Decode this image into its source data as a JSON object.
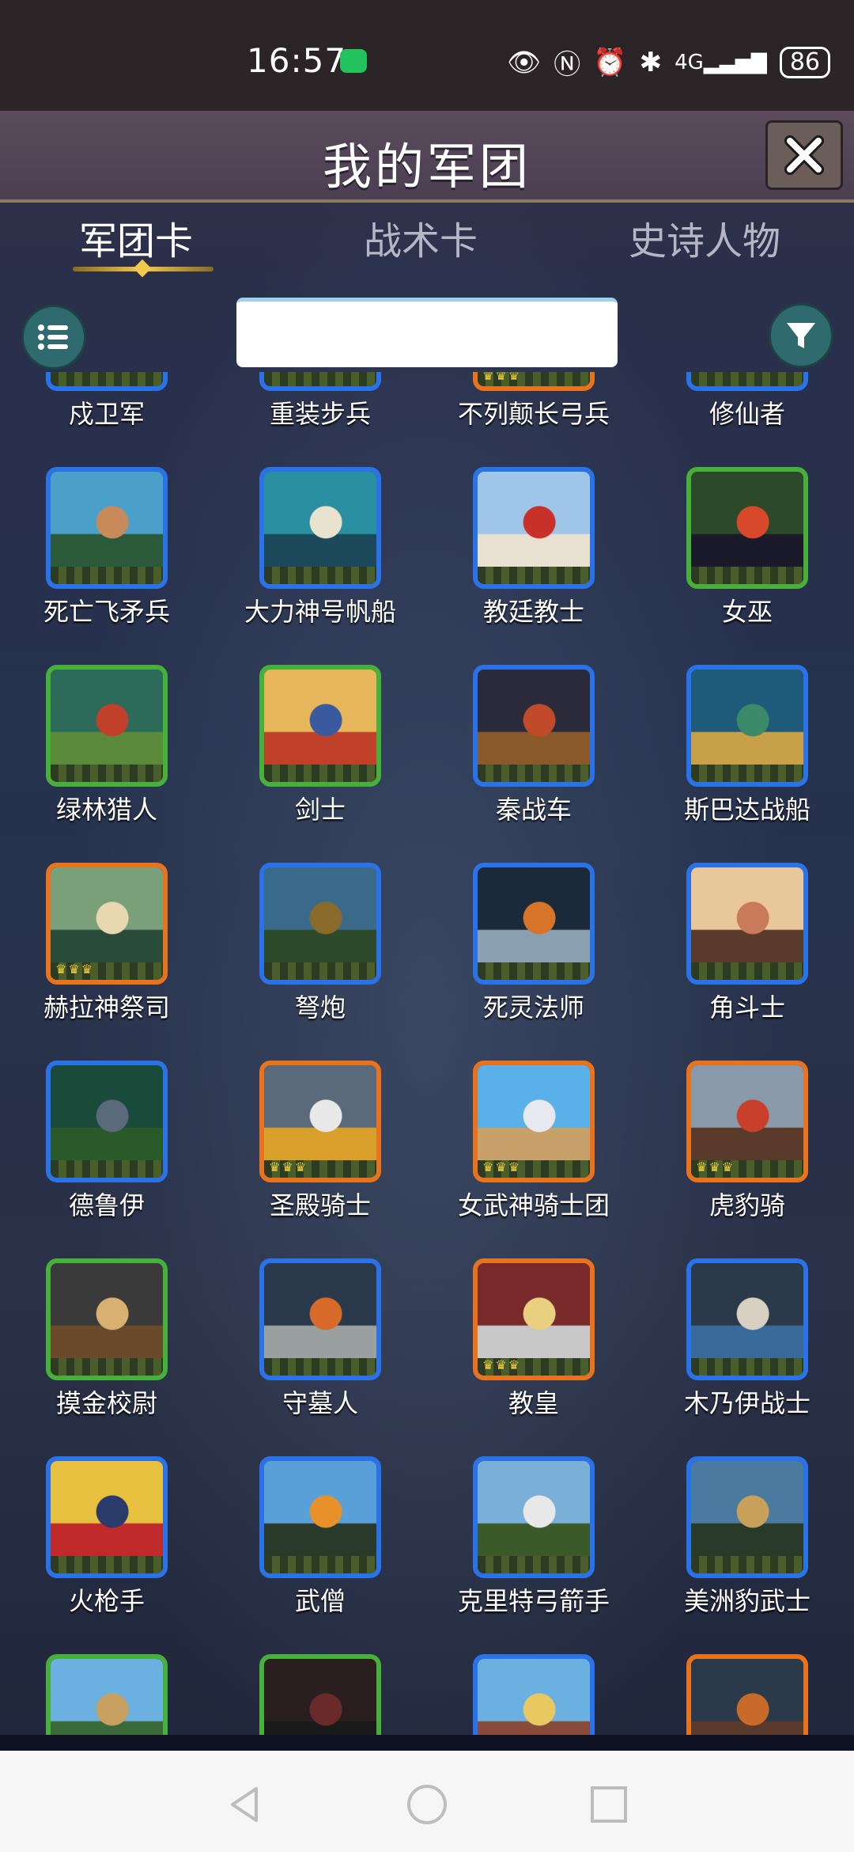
{
  "status_bar": {
    "time": "16:57",
    "battery": "86",
    "icons": [
      "wechat-icon",
      "eye-icon",
      "nfc-icon",
      "alarm-icon",
      "bluetooth-icon",
      "signal-4g-icon"
    ]
  },
  "header": {
    "title": "我的军团",
    "close_icon": "close-icon"
  },
  "tabs": [
    {
      "label": "军团卡",
      "active": true
    },
    {
      "label": "战术卡",
      "active": false
    },
    {
      "label": "史诗人物",
      "active": false
    }
  ],
  "controls": {
    "search_value": "",
    "list_icon": "list-icon",
    "filter_icon": "filter-icon"
  },
  "cards": [
    {
      "name": "戍卫军",
      "rarity": "blue",
      "art": "soldiers"
    },
    {
      "name": "重装步兵",
      "rarity": "blue",
      "art": "infantry"
    },
    {
      "name": "不列颠长弓兵",
      "rarity": "orange",
      "art": "archers"
    },
    {
      "name": "修仙者",
      "rarity": "blue",
      "art": "cultivator"
    },
    {
      "name": "死亡飞矛兵",
      "rarity": "blue",
      "art": "spear"
    },
    {
      "name": "大力神号帆船",
      "rarity": "blue",
      "art": "ship"
    },
    {
      "name": "教廷教士",
      "rarity": "blue",
      "art": "templar"
    },
    {
      "name": "女巫",
      "rarity": "green",
      "art": "witch"
    },
    {
      "name": "绿林猎人",
      "rarity": "green",
      "art": "hunter"
    },
    {
      "name": "剑士",
      "rarity": "green",
      "art": "swordsman"
    },
    {
      "name": "秦战车",
      "rarity": "blue",
      "art": "chariot"
    },
    {
      "name": "斯巴达战船",
      "rarity": "blue",
      "art": "trireme"
    },
    {
      "name": "赫拉神祭司",
      "rarity": "orange",
      "art": "priestess"
    },
    {
      "name": "弩炮",
      "rarity": "blue",
      "art": "ballista"
    },
    {
      "name": "死灵法师",
      "rarity": "blue",
      "art": "necromancer"
    },
    {
      "name": "角斗士",
      "rarity": "blue",
      "art": "gladiator"
    },
    {
      "name": "德鲁伊",
      "rarity": "blue",
      "art": "druid"
    },
    {
      "name": "圣殿骑士",
      "rarity": "orange",
      "art": "knight"
    },
    {
      "name": "女武神骑士团",
      "rarity": "orange",
      "art": "valkyrie"
    },
    {
      "name": "虎豹骑",
      "rarity": "orange",
      "art": "cavalry"
    },
    {
      "name": "摸金校尉",
      "rarity": "green",
      "art": "tomb"
    },
    {
      "name": "守墓人",
      "rarity": "blue",
      "art": "gravekeeper"
    },
    {
      "name": "教皇",
      "rarity": "orange",
      "art": "pope"
    },
    {
      "name": "木乃伊战士",
      "rarity": "blue",
      "art": "mummy"
    },
    {
      "name": "火枪手",
      "rarity": "blue",
      "art": "musketeers"
    },
    {
      "name": "武僧",
      "rarity": "blue",
      "art": "monk"
    },
    {
      "name": "克里特弓箭手",
      "rarity": "blue",
      "art": "cretan"
    },
    {
      "name": "美洲豹武士",
      "rarity": "blue",
      "art": "jaguar"
    },
    {
      "name": "",
      "rarity": "green",
      "art": "cross"
    },
    {
      "name": "",
      "rarity": "green",
      "art": "forest"
    },
    {
      "name": "",
      "rarity": "blue",
      "art": "saint"
    },
    {
      "name": "",
      "rarity": "orange",
      "art": "warrior"
    }
  ],
  "nav_bar": {
    "back_icon": "back-icon",
    "home_icon": "home-icon",
    "recents_icon": "recents-icon"
  }
}
